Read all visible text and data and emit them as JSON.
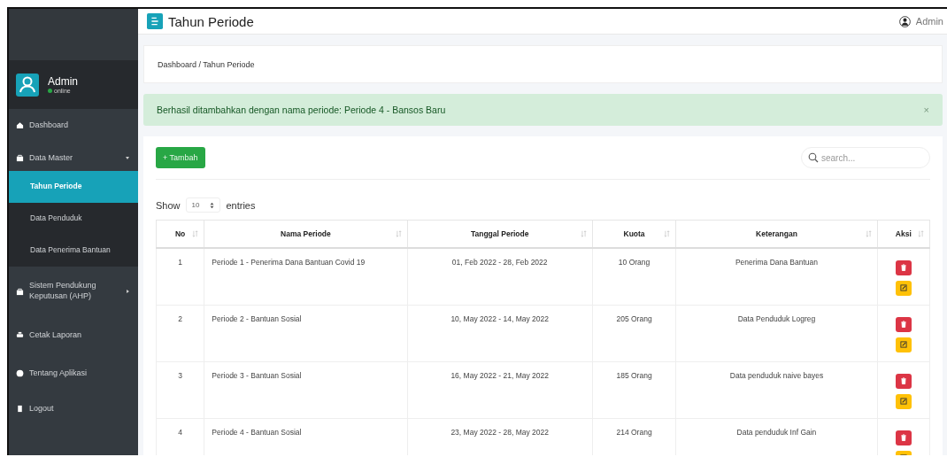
{
  "sidebar": {
    "user": {
      "name": "Admin",
      "status": "online"
    },
    "items": [
      {
        "label": "Dashboard",
        "selected": false
      },
      {
        "label": "Data Master",
        "selected": false,
        "expanded": true,
        "children": [
          {
            "label": "Tahun Periode",
            "selected": true
          },
          {
            "label": "Data Penduduk",
            "selected": false
          },
          {
            "label": "Data Penerima Bantuan",
            "selected": false
          }
        ]
      },
      {
        "label": "Sistem Pendukung Keputusan (AHP)",
        "selected": false,
        "expanded": false
      },
      {
        "label": "Cetak Laporan",
        "selected": false
      },
      {
        "label": "Tentang Aplikasi",
        "selected": false
      },
      {
        "label": "Logout",
        "selected": false
      }
    ]
  },
  "header": {
    "title": "Tahun Periode",
    "user": "Admin"
  },
  "breadcrumb": "Dashboard / Tahun Periode",
  "alert": {
    "message": "Berhasil ditambahkan dengan nama periode: Periode 4 - Bansos Baru",
    "close": "×"
  },
  "toolbar": {
    "add_button": "+ Tambah",
    "search": {
      "placeholder": "search..."
    }
  },
  "length": {
    "before": "Show",
    "value": "10",
    "after": "entries"
  },
  "table": {
    "columns": [
      "No",
      "Nama Periode",
      "Tanggal Periode",
      "Kuota",
      "Keterangan",
      "Aksi"
    ],
    "rows": [
      [
        "1",
        "Periode 1 - Penerima Dana Bantuan Covid 19",
        "01, Feb 2022 - 28, Feb 2022",
        "10 Orang",
        "Penerima Dana Bantuan"
      ],
      [
        "2",
        "Periode 2 - Bantuan Sosial",
        "10, May 2022 - 14, May 2022",
        "205 Orang",
        "Data Penduduk Logreg"
      ],
      [
        "3",
        "Periode 3 - Bantuan Sosial",
        "16, May 2022 - 21, May 2022",
        "185 Orang",
        "Data penduduk naive bayes"
      ],
      [
        "4",
        "Periode 4 - Bantuan Sosial",
        "23, May 2022 - 28, May 2022",
        "214 Orang",
        "Data penduduk Inf Gain"
      ]
    ]
  }
}
